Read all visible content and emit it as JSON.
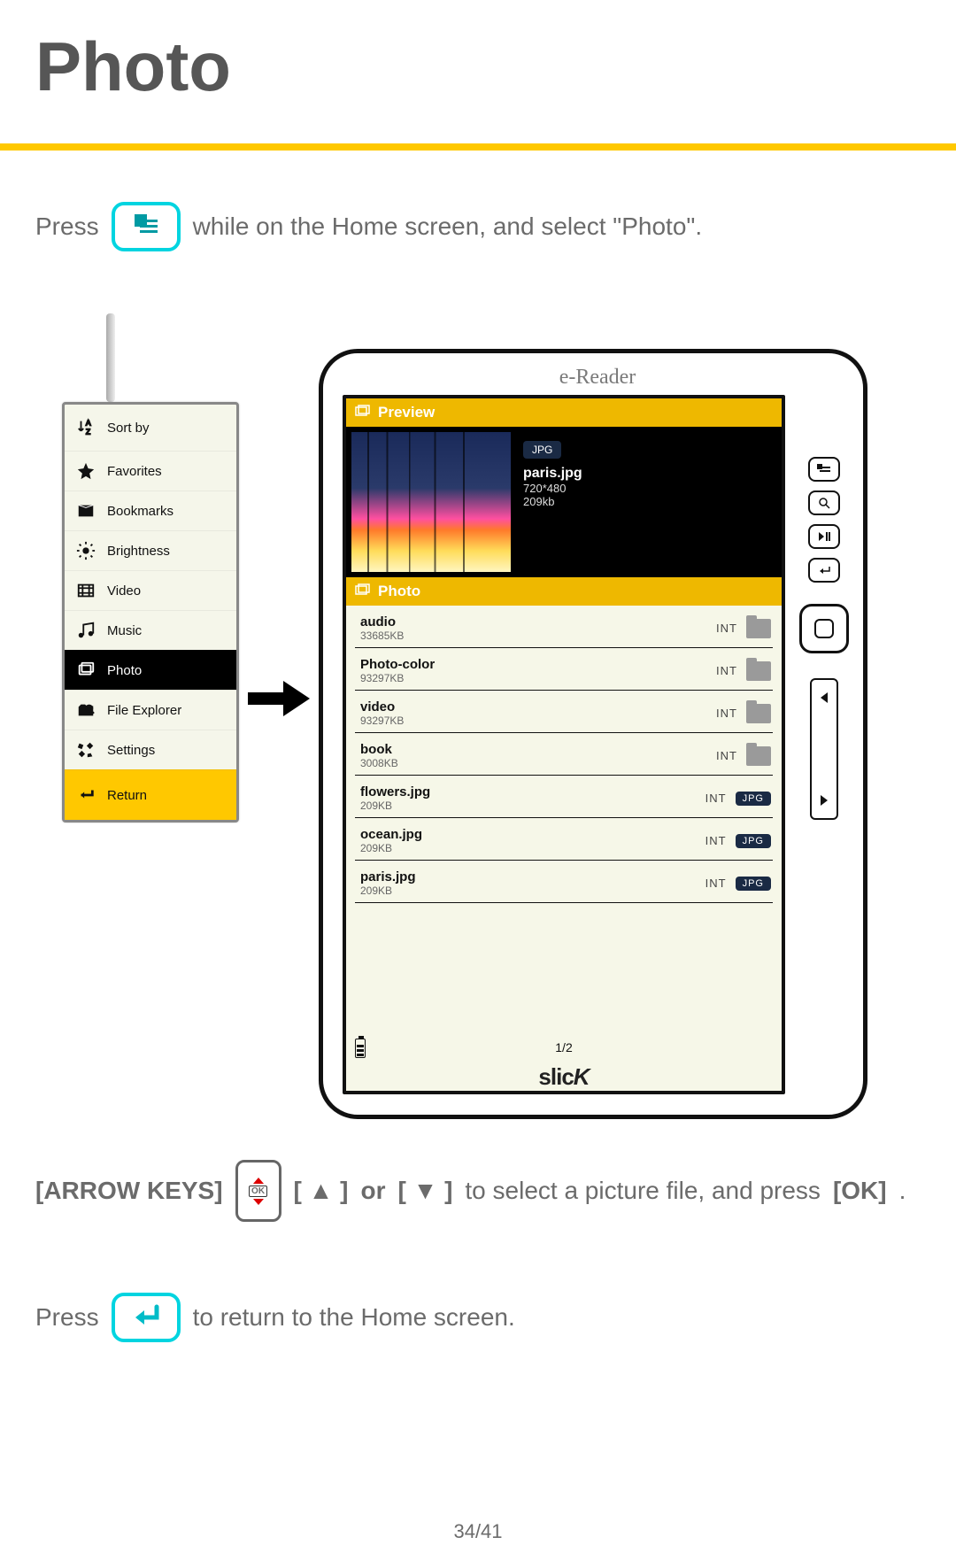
{
  "page": {
    "title": "Photo",
    "number": "34/41"
  },
  "instructions": {
    "press_prefix": "Press",
    "line1_suffix": "while on the Home screen, and select \"Photo\".",
    "arrow_keys_label": "[ARROW KEYS]",
    "line2_mid_a": "[ ▲ ]",
    "line2_or": "or",
    "line2_mid_b": "[ ▼ ]",
    "line2_suffix_a": "to select a picture file, and press",
    "ok_label": "[OK]",
    "line2_suffix_b": ".",
    "line3_suffix": "to return to the Home screen."
  },
  "menu": {
    "items": [
      {
        "label": "Sort by"
      },
      {
        "label": "Favorites"
      },
      {
        "label": "Bookmarks"
      },
      {
        "label": "Brightness"
      },
      {
        "label": "Video"
      },
      {
        "label": "Music"
      },
      {
        "label": "Photo"
      },
      {
        "label": "File Explorer"
      },
      {
        "label": "Settings"
      }
    ],
    "return_label": "Return"
  },
  "device": {
    "title": "e-Reader",
    "brand": "slicK",
    "preview_header": "Preview",
    "photo_header": "Photo",
    "preview": {
      "badge": "JPG",
      "filename": "paris.jpg",
      "dimensions": "720*480",
      "size": "209kb"
    },
    "files": [
      {
        "name": "audio",
        "size": "33685KB",
        "loc": "INT",
        "type": "folder"
      },
      {
        "name": "Photo-color",
        "size": "93297KB",
        "loc": "INT",
        "type": "folder"
      },
      {
        "name": "video",
        "size": "93297KB",
        "loc": "INT",
        "type": "folder"
      },
      {
        "name": "book",
        "size": "3008KB",
        "loc": "INT",
        "type": "folder"
      },
      {
        "name": "flowers.jpg",
        "size": "209KB",
        "loc": "INT",
        "type": "jpg"
      },
      {
        "name": "ocean.jpg",
        "size": "209KB",
        "loc": "INT",
        "type": "jpg"
      },
      {
        "name": "paris.jpg",
        "size": "209KB",
        "loc": "INT",
        "type": "jpg"
      }
    ],
    "pagination": "1/2"
  }
}
